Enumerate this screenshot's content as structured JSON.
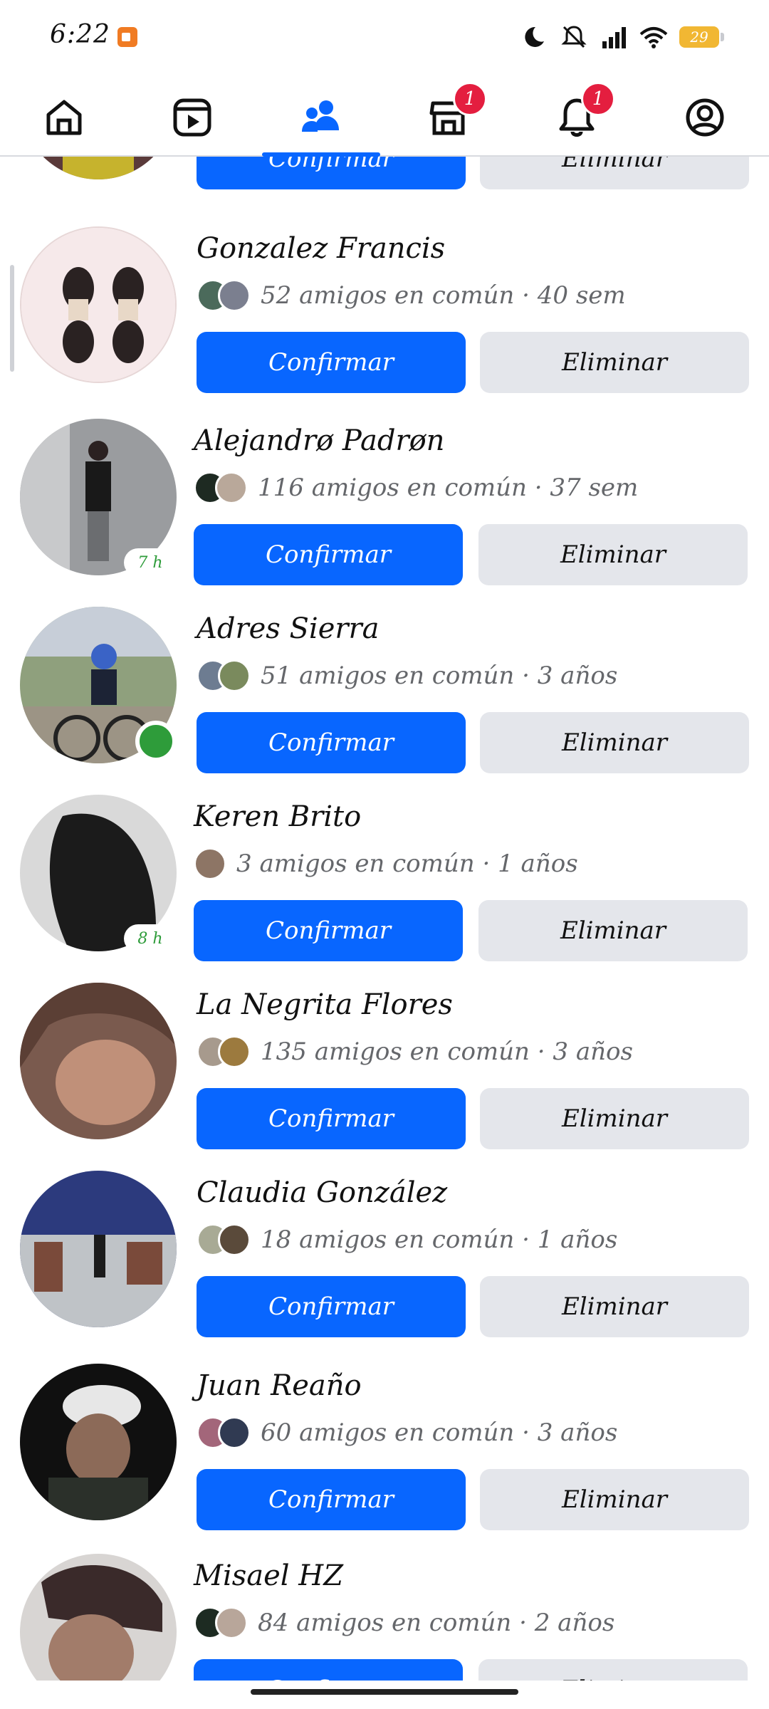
{
  "status_bar": {
    "time": "6:22",
    "battery": "29"
  },
  "nav": {
    "items": [
      {
        "name": "home",
        "badge": ""
      },
      {
        "name": "video",
        "badge": ""
      },
      {
        "name": "friends",
        "badge": ""
      },
      {
        "name": "marketplace",
        "badge": "1"
      },
      {
        "name": "notifications",
        "badge": "1"
      },
      {
        "name": "profile",
        "badge": ""
      }
    ]
  },
  "requests": [
    {
      "name": "",
      "mutual": "",
      "confirm": "Confirmar",
      "delete": "Eliminar"
    },
    {
      "name": "Gonzalez Francis",
      "mutual": "52 amigos en común · 40 sem",
      "confirm": "Confirmar",
      "delete": "Eliminar"
    },
    {
      "name": "Alejandrø Padrøn",
      "mutual": "116 amigos en común · 37 sem",
      "confirm": "Confirmar",
      "delete": "Eliminar",
      "time": "7 h"
    },
    {
      "name": "Adres Sierra",
      "mutual": "51 amigos en común · 3 años",
      "confirm": "Confirmar",
      "delete": "Eliminar"
    },
    {
      "name": "Keren Brito",
      "mutual": "3 amigos en común · 1 años",
      "confirm": "Confirmar",
      "delete": "Eliminar",
      "time": "8 h"
    },
    {
      "name": "La Negrita Flores",
      "mutual": "135 amigos en común · 3 años",
      "confirm": "Confirmar",
      "delete": "Eliminar"
    },
    {
      "name": "Claudia González",
      "mutual": "18 amigos en común · 1 años",
      "confirm": "Confirmar",
      "delete": "Eliminar"
    },
    {
      "name": "Juan Reaño",
      "mutual": "60 amigos en común · 3 años",
      "confirm": "Confirmar",
      "delete": "Eliminar"
    },
    {
      "name": "Misael HZ",
      "mutual": "84 amigos en común · 2 años",
      "confirm": "Confirmar",
      "delete": "Eliminar"
    }
  ],
  "colors": {
    "accent": "#0866ff",
    "secondary_button": "#e4e6eb",
    "badge": "#e41e3f",
    "online": "#2e9c3a"
  }
}
